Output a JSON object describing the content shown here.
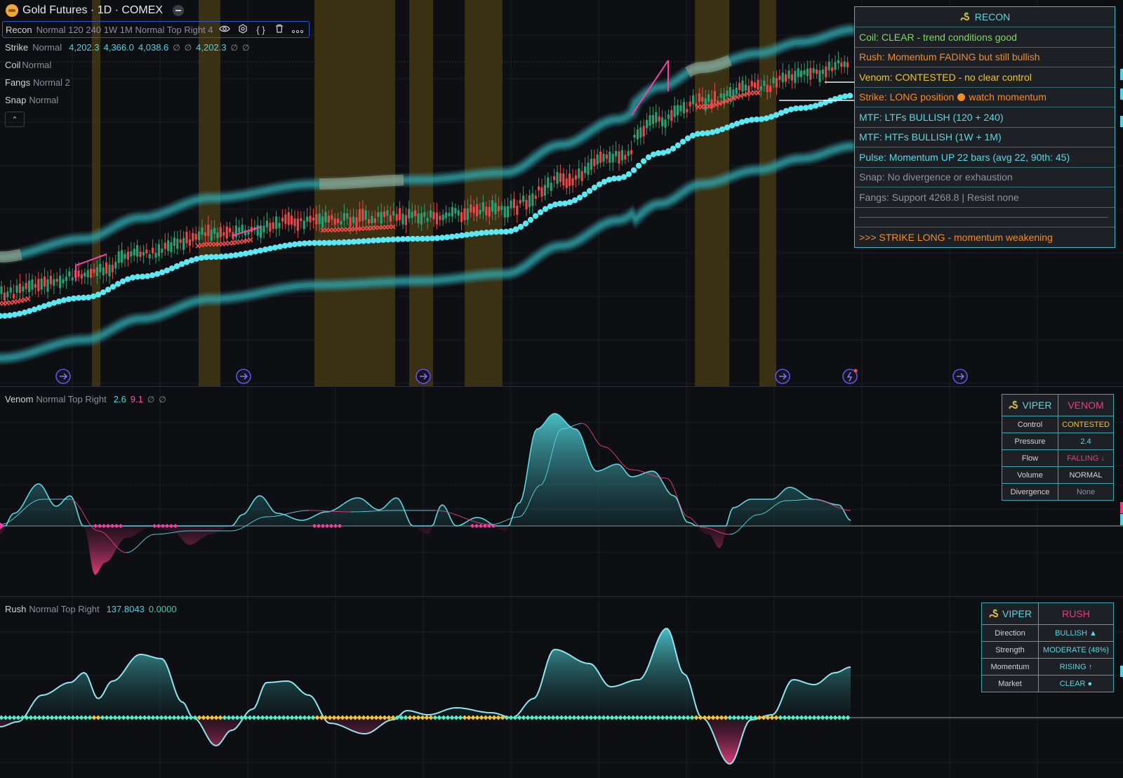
{
  "header": {
    "title": "Gold Futures · 1D · COMEX",
    "recon_legend": {
      "name": "Recon",
      "params": "Normal 120 240 1W 1M Normal Top Right 4"
    },
    "strike_legend": {
      "name": "Strike",
      "params": "Normal",
      "v1": "4,202.3",
      "v2": "4,366.0",
      "v3": "4,038.6",
      "na1": "∅",
      "na2": "∅",
      "v4": "4,202.3",
      "na3": "∅",
      "na4": "∅"
    },
    "coil_legend": {
      "name": "Coil",
      "params": "Normal"
    },
    "fangs_legend": {
      "name": "Fangs",
      "params": "Normal 2"
    },
    "snap_legend": {
      "name": "Snap",
      "params": "Normal"
    },
    "toolbar_icons": [
      "eye-icon",
      "settings-icon",
      "source-code-icon",
      "trash-icon",
      "more-icon"
    ]
  },
  "recon_panel": {
    "title": "RECON",
    "rows": [
      {
        "text": "Coil: CLEAR - trend conditions good",
        "color": "#7cdc62"
      },
      {
        "text": "Rush: Momentum FADING but still bullish",
        "color": "#f28b2a"
      },
      {
        "text": "Venom: CONTESTED - no clear control",
        "color": "#e9c53a"
      },
      {
        "text": "Strike: LONG position",
        "suffix": "watch momentum",
        "color": "#f28b2a"
      },
      {
        "text": "MTF: LTFs BULLISH (120 + 240)",
        "color": "#5fd6e2"
      },
      {
        "text": "MTF: HTFs BULLISH (1W + 1M)",
        "color": "#5fd6e2"
      },
      {
        "text": "Pulse: Momentum UP 22 bars (avg 22, 90th: 45)",
        "color": "#5fd6e2"
      },
      {
        "text": "Snap: No divergence or exhaustion",
        "color": "#8d939e"
      },
      {
        "text": "Fangs: Support 4268.8 | Resist none",
        "color": "#8d939e"
      },
      {
        "text": "",
        "color": "#8d939e",
        "divider": true
      },
      {
        "text": ">>> STRIKE LONG - momentum weakening",
        "color": "#f28b2a"
      }
    ]
  },
  "venom": {
    "legend": {
      "name": "Venom",
      "params": "Normal Top Right",
      "v1": "2.6",
      "v2": "9.1",
      "na1": "∅",
      "na2": "∅"
    },
    "table": {
      "head_left": "VIPER",
      "head_right": "VENOM",
      "rows": [
        {
          "label": "Control",
          "value": "CONTESTED",
          "color": "#e9c53a"
        },
        {
          "label": "Pressure",
          "value": "2.4",
          "color": "#5fd6e2"
        },
        {
          "label": "Flow",
          "value": "FALLING ↓",
          "color": "#e8407e"
        },
        {
          "label": "Volume",
          "value": "NORMAL",
          "color": "#d1d4dc"
        },
        {
          "label": "Divergence",
          "value": "None",
          "color": "#8d939e"
        }
      ]
    }
  },
  "rush": {
    "legend": {
      "name": "Rush",
      "params": "Normal Top Right",
      "v1": "137.8043",
      "v2": "0.0000"
    },
    "table": {
      "head_left": "VIPER",
      "head_right": "RUSH",
      "rows": [
        {
          "label": "Direction",
          "value": "BULLISH ▲",
          "color": "#5fd6e2"
        },
        {
          "label": "Strength",
          "value": "MODERATE (48%)",
          "color": "#5fd6e2"
        },
        {
          "label": "Momentum",
          "value": "RISING ↑",
          "color": "#5fd6e2"
        },
        {
          "label": "Market",
          "value": "CLEAR ●",
          "color": "#5fd6e2"
        }
      ]
    }
  },
  "colors": {
    "background": "#0e0f12",
    "teal": "#4dd4e0",
    "magenta": "#e8407e",
    "bull_candle": "#2e9e72",
    "bear_candle": "#e24a4a",
    "session_band": "#4a3c14",
    "marker": "#6a4df0"
  }
}
